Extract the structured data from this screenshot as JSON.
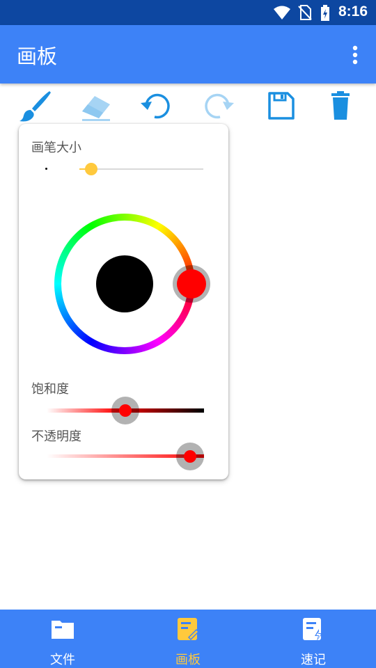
{
  "status_bar": {
    "time": "8:16"
  },
  "app_bar": {
    "title": "画板"
  },
  "toolbar": {
    "tools": [
      "brush",
      "eraser",
      "undo",
      "redo",
      "save",
      "delete"
    ]
  },
  "panel": {
    "brush_size": {
      "label": "画笔大小",
      "value": 0.05
    },
    "color_wheel": {
      "selected_color": "#ff0000",
      "preview_color": "#000000"
    },
    "saturation": {
      "label": "饱和度",
      "value": 0.5
    },
    "opacity": {
      "label": "不透明度",
      "value": 1.0
    }
  },
  "bottom_nav": {
    "items": [
      {
        "label": "文件",
        "active": false
      },
      {
        "label": "画板",
        "active": true
      },
      {
        "label": "速记",
        "active": false
      }
    ]
  },
  "colors": {
    "primary": "#3d82f7",
    "status_bar": "#0d47a1",
    "active_nav": "#ffc93d",
    "tool_icon": "#1a8fe0"
  }
}
